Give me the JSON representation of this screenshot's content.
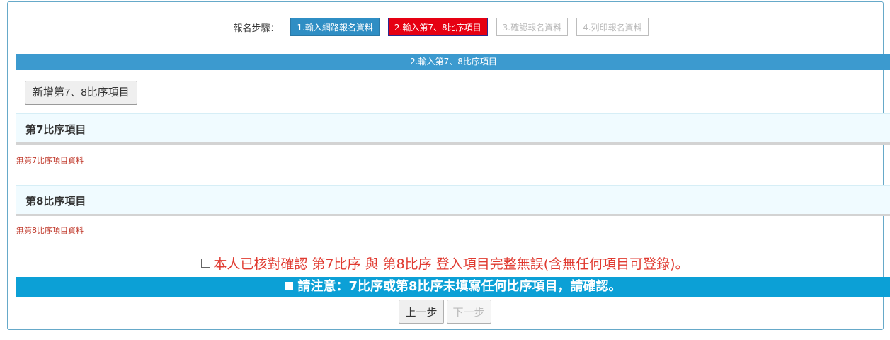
{
  "steps": {
    "label": "報名步驟：",
    "items": [
      {
        "label": "1.輸入網路報名資料"
      },
      {
        "label": "2.輸入第7、8比序項目"
      },
      {
        "label": "3.確認報名資料"
      },
      {
        "label": "4.列印報名資料"
      }
    ]
  },
  "title": "2.輸入第7、8比序項目",
  "add_button": "新增第7、8比序項目",
  "sections": [
    {
      "heading": "第7比序項目",
      "empty_text": "無第7比序項目資料"
    },
    {
      "heading": "第8比序項目",
      "empty_text": "無第8比序項目資料"
    }
  ],
  "confirm_text": "本人已核對確認 第7比序 與 第8比序 登入項目完整無誤(含無任何項目可登錄)。",
  "notice_text": "請注意：7比序或第8比序未填寫任何比序項目，請確認。",
  "nav": {
    "prev": "上一步",
    "next": "下一步"
  },
  "colors": {
    "step_active": "#e60012",
    "step_done": "#2f8ec4",
    "titlebar": "#3c9acf",
    "notice": "#0ca0d6",
    "warning_text": "#e03a30"
  }
}
